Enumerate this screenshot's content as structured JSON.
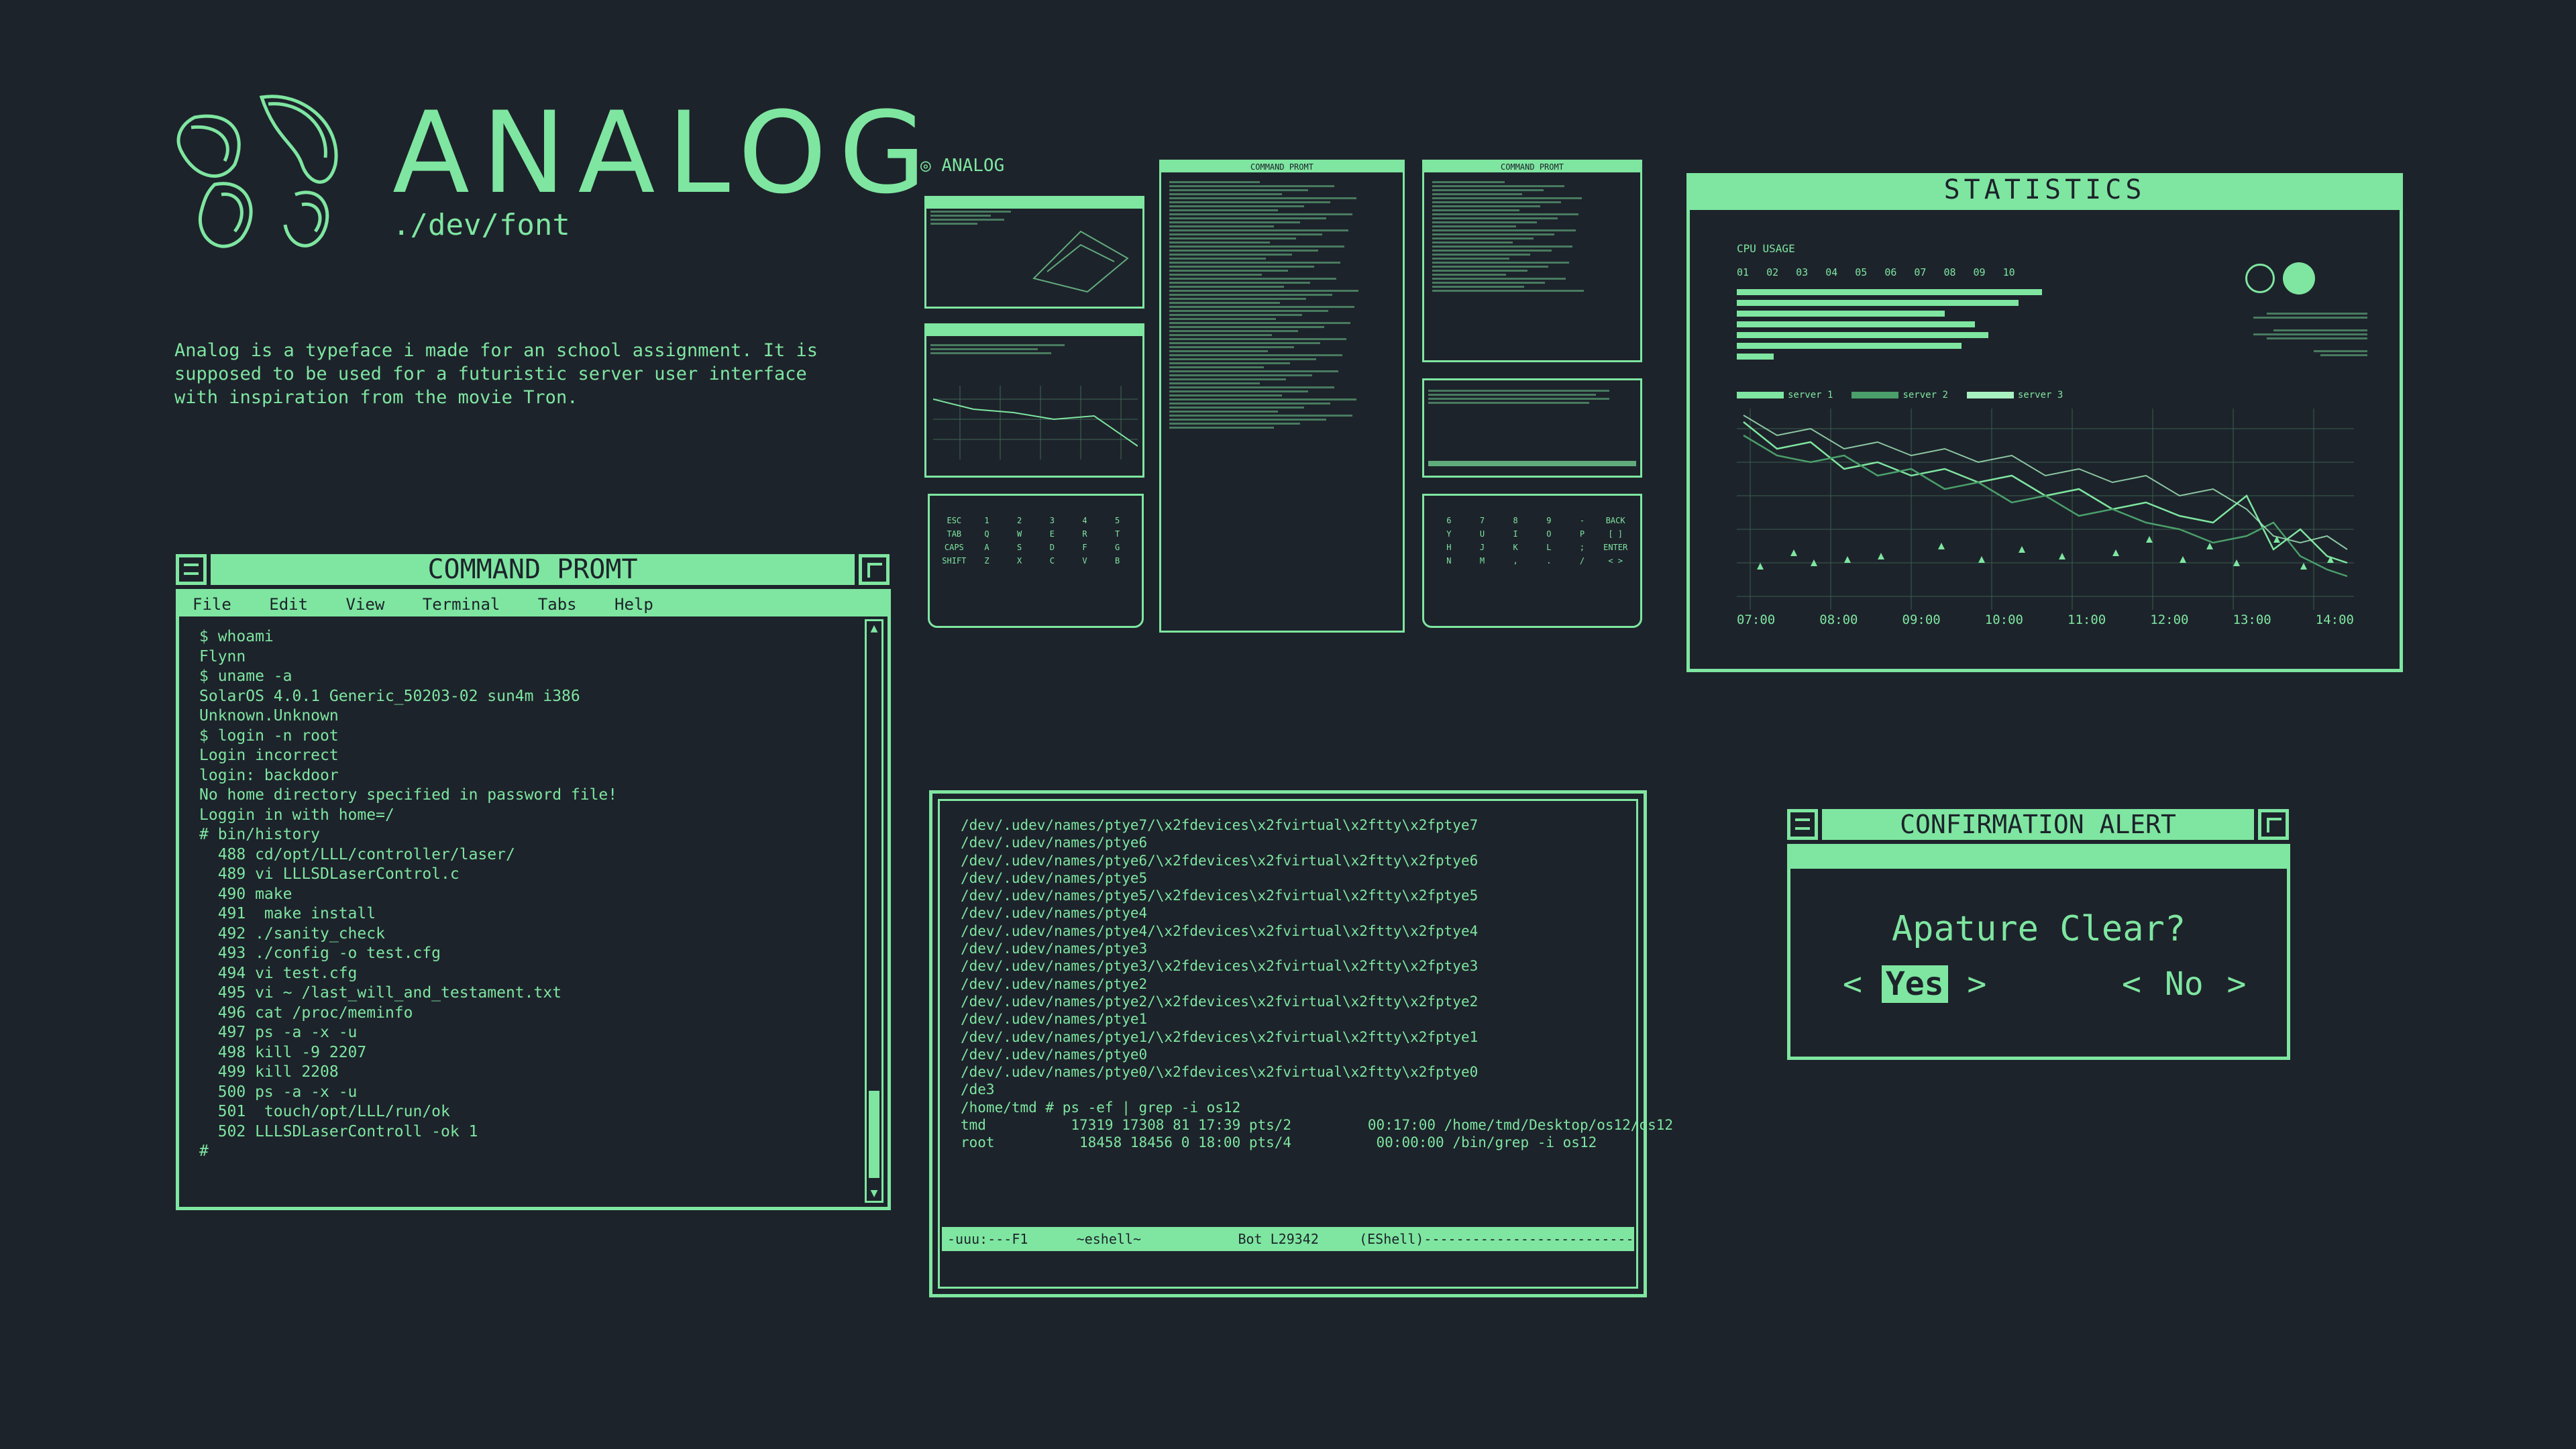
{
  "brand": {
    "title": "ANALOG",
    "subtitle": "./dev/font",
    "description": "Analog is a typeface i made for an school assignment. It is supposed to be used for a futuristic server user interface with inspiration from the movie Tron.",
    "colors": {
      "accent": "#7ee6a0",
      "background": "#1d232b"
    }
  },
  "command_prompt": {
    "title": "COMMAND PROMT",
    "menu": [
      "File",
      "Edit",
      "View",
      "Terminal",
      "Tabs",
      "Help"
    ],
    "lines": [
      "$ whoami",
      "Flynn",
      "$ uname -a",
      "SolarOS 4.0.1 Generic_50203-02 sun4m i386",
      "Unknown.Unknown",
      "$ login -n root",
      "Login incorrect",
      "login: backdoor",
      "No home directory specified in password file!",
      "Loggin in with home=/",
      "# bin/history",
      "  488 cd/opt/LLL/controller/laser/",
      "  489 vi LLLSDLaserControl.c",
      "  490 make",
      "  491  make install",
      "  492 ./sanity_check",
      "  493 ./config -o test.cfg",
      "  494 vi test.cfg",
      "  495 vi ~ /last_will_and_testament.txt",
      "  496 cat /proc/meminfo",
      "  497 ps -a -x -u",
      "  498 kill -9 2207",
      "  499 kill 2208",
      "  500 ps -a -x -u",
      "  501  touch/opt/LLL/run/ok",
      "  502 LLLSDLaserControll -ok 1",
      "#"
    ]
  },
  "terminal": {
    "lines": [
      "/dev/.udev/names/ptye7/\\x2fdevices\\x2fvirtual\\x2ftty\\x2fptye7",
      "/dev/.udev/names/ptye6",
      "/dev/.udev/names/ptye6/\\x2fdevices\\x2fvirtual\\x2ftty\\x2fptye6",
      "/dev/.udev/names/ptye5",
      "/dev/.udev/names/ptye5/\\x2fdevices\\x2fvirtual\\x2ftty\\x2fptye5",
      "/dev/.udev/names/ptye4",
      "/dev/.udev/names/ptye4/\\x2fdevices\\x2fvirtual\\x2ftty\\x2fptye4",
      "/dev/.udev/names/ptye3",
      "/dev/.udev/names/ptye3/\\x2fdevices\\x2fvirtual\\x2ftty\\x2fptye3",
      "/dev/.udev/names/ptye2",
      "/dev/.udev/names/ptye2/\\x2fdevices\\x2fvirtual\\x2ftty\\x2fptye2",
      "/dev/.udev/names/ptye1",
      "/dev/.udev/names/ptye1/\\x2fdevices\\x2fvirtual\\x2ftty\\x2fptye1",
      "/dev/.udev/names/ptye0",
      "/dev/.udev/names/ptye0/\\x2fdevices\\x2fvirtual\\x2ftty\\x2fptye0",
      "/de3",
      "/home/tmd # ps -ef | grep -i os12",
      "tmd          17319 17308 81 17:39 pts/2         00:17:00 /home/tmd/Desktop/os12/os12",
      "root          18458 18456 0 18:00 pts/4          00:00:00 /bin/grep -i os12"
    ],
    "status": "-uuu:---F1      ~eshell~            Bot L29342     (EShell)-----------------------------------------------------------"
  },
  "statistics": {
    "title": "STATISTICS",
    "section": "CPU USAGE",
    "cpu_labels": [
      "01",
      "02",
      "03",
      "04",
      "05",
      "06",
      "07",
      "08",
      "09",
      "10"
    ],
    "legend": [
      "server 1",
      "server 2",
      "server 3"
    ],
    "times": [
      "07:00",
      "08:00",
      "09:00",
      "10:00",
      "11:00",
      "12:00",
      "13:00",
      "14:00"
    ]
  },
  "alert": {
    "title": "CONFIRMATION ALERT",
    "question": "Apature Clear?",
    "yes": "Yes",
    "no": "No",
    "lt": "<",
    "gt": ">"
  },
  "keyboard_left": [
    "ESC",
    "1",
    "2",
    "3",
    "4",
    "5",
    "TAB",
    "Q",
    "W",
    "E",
    "R",
    "T",
    "CAPS",
    "A",
    "S",
    "D",
    "F",
    "G",
    "SHIFT",
    "Z",
    "X",
    "C",
    "V",
    "B"
  ],
  "keyboard_right": [
    "6",
    "7",
    "8",
    "9",
    "-",
    "BACK",
    "Y",
    "U",
    "I",
    "O",
    "P",
    "[ ]",
    "H",
    "J",
    "K",
    "L",
    ";",
    "ENTER",
    "N",
    "M",
    ",",
    ".",
    "/",
    "< >"
  ]
}
